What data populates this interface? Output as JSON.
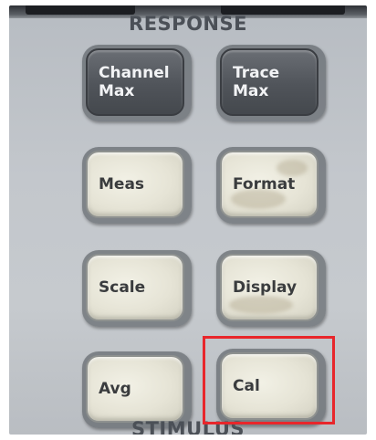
{
  "panel": {
    "section_top": "RESPONSE",
    "section_bottom": "STIMULUS"
  },
  "keys": [
    {
      "label": "Channel\nMax",
      "style": "dark"
    },
    {
      "label": "Trace\nMax",
      "style": "dark"
    },
    {
      "label": "Meas",
      "style": "light"
    },
    {
      "label": "Format",
      "style": "light"
    },
    {
      "label": "Scale",
      "style": "light"
    },
    {
      "label": "Display",
      "style": "light"
    },
    {
      "label": "Avg",
      "style": "light"
    },
    {
      "label": "Cal",
      "style": "light"
    }
  ],
  "highlight": {
    "target": "Cal",
    "color": "#e8262b"
  }
}
